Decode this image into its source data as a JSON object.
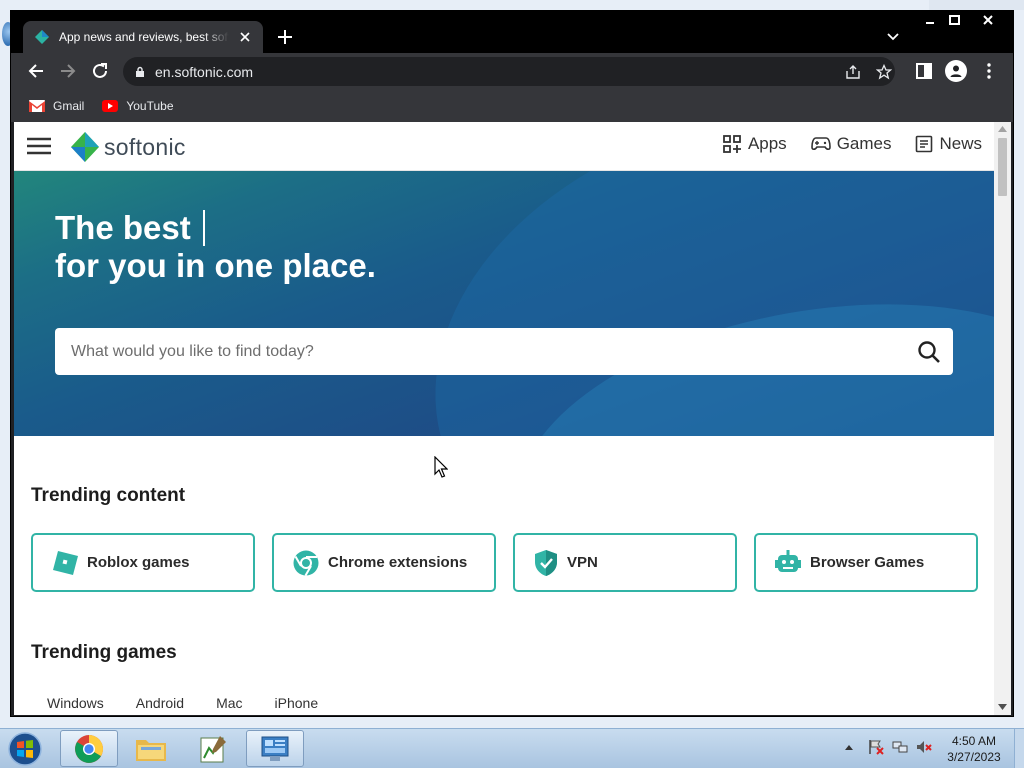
{
  "browser": {
    "tab_title": "App news and reviews, best software downloads and discovery",
    "url": "en.softonic.com",
    "bookmarks": [
      {
        "label": "Gmail",
        "icon": "gmail-icon"
      },
      {
        "label": "YouTube",
        "icon": "youtube-icon"
      }
    ]
  },
  "site": {
    "logo_text": "softonic",
    "nav": [
      {
        "label": "Apps",
        "icon": "apps-grid-icon"
      },
      {
        "label": "Games",
        "icon": "gamepad-icon"
      },
      {
        "label": "News",
        "icon": "news-icon"
      }
    ],
    "hero": {
      "line1": "The best",
      "line2": "for you in one place."
    },
    "search": {
      "placeholder": "What would you like to find today?",
      "value": ""
    },
    "trending_content_title": "Trending content",
    "trending_cards": [
      {
        "label": "Roblox games",
        "icon": "roblox-icon"
      },
      {
        "label": "Chrome extensions",
        "icon": "chrome-icon"
      },
      {
        "label": "VPN",
        "icon": "shield-icon"
      },
      {
        "label": "Browser Games",
        "icon": "robot-icon"
      }
    ],
    "trending_games_title": "Trending games",
    "platform_tabs": [
      "Windows",
      "Android",
      "Mac",
      "iPhone"
    ]
  },
  "taskbar": {
    "time": "4:50 AM",
    "date": "3/27/2023"
  },
  "colors": {
    "accent_teal": "#31b4a6",
    "hero_blue": "#1a5b8b",
    "chrome_dark": "#202124"
  }
}
